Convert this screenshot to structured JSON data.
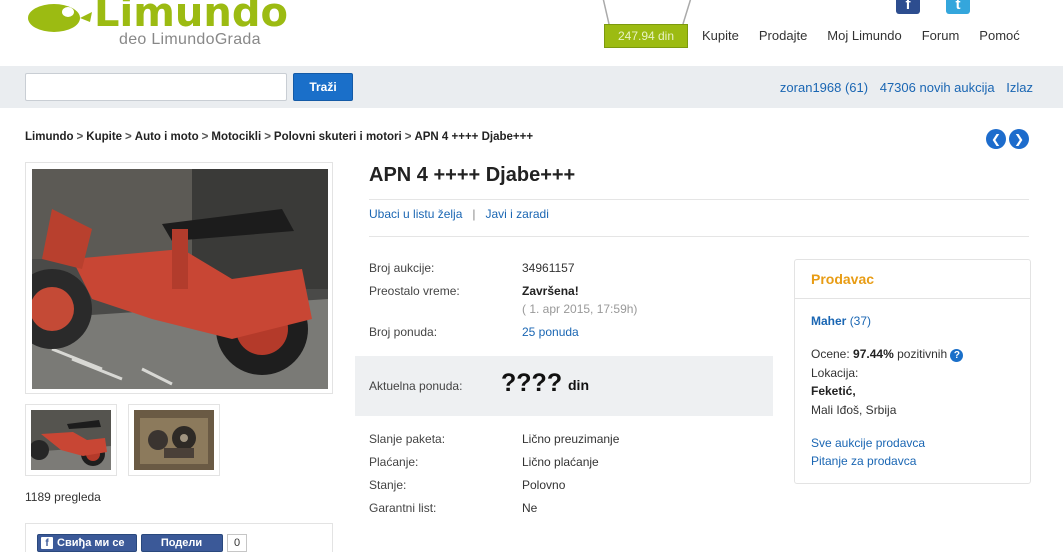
{
  "header": {
    "brand": "Limundo",
    "tagline": "deo LimundoGrada",
    "balance": "247.94 din",
    "nav": [
      "Kupite",
      "Prodajte",
      "Moj Limundo",
      "Forum",
      "Pomoć"
    ],
    "facebook_glyph": "f",
    "twitter_glyph": "t"
  },
  "search": {
    "value": "",
    "button_label": "Traži"
  },
  "user": {
    "username": "zoran1968 (61)",
    "new_auctions": "47306 novih aukcija",
    "logout": "Izlaz"
  },
  "breadcrumb": {
    "items": [
      "Limundo",
      "Kupite",
      "Auto i moto",
      "Motocikli",
      "Polovni skuteri i motori"
    ],
    "current": "APN 4 ++++ Djabe+++",
    "separator": ">"
  },
  "listing": {
    "title": "APN 4 ++++ Djabe+++",
    "wishlist": "Ubaci u listu želja",
    "report": "Javi i zaradi",
    "views": "1189 pregleda"
  },
  "details": {
    "auction_label": "Broj aukcije:",
    "auction_value": "34961157",
    "time_label": "Preostalo vreme:",
    "time_value": "Završena!",
    "time_sub": "( 1. apr 2015, 17:59h)",
    "bids_label": "Broj ponuda:",
    "bids_value": "25 ponuda",
    "current_label": "Aktuelna ponuda:",
    "current_value": "????",
    "currency": "din",
    "shipping_label": "Slanje paketa:",
    "shipping_value": "Lično preuzimanje",
    "payment_label": "Plaćanje:",
    "payment_value": "Lično plaćanje",
    "condition_label": "Stanje:",
    "condition_value": "Polovno",
    "warranty_label": "Garantni list:",
    "warranty_value": "Ne"
  },
  "seller": {
    "heading": "Prodavac",
    "name": "Maher",
    "rating_count": "(37)",
    "score_label": "Ocene:",
    "score_value": "97.44%",
    "score_suffix": "pozitivnih",
    "location_label": "Lokacija:",
    "location_city": "Feketić,",
    "location_region": "Mali Iđoš, Srbija",
    "all_auctions": "Sve aukcije prodavca",
    "ask": "Pitanje za prodavca"
  },
  "social": {
    "like_label": "Свиђа ми се",
    "share_label": "Подели",
    "like_count": "0"
  },
  "colors": {
    "brand_green": "#9cbb12",
    "link_blue": "#1a66b3",
    "button_blue": "#1a6fc9",
    "seller_orange": "#e89c14"
  }
}
